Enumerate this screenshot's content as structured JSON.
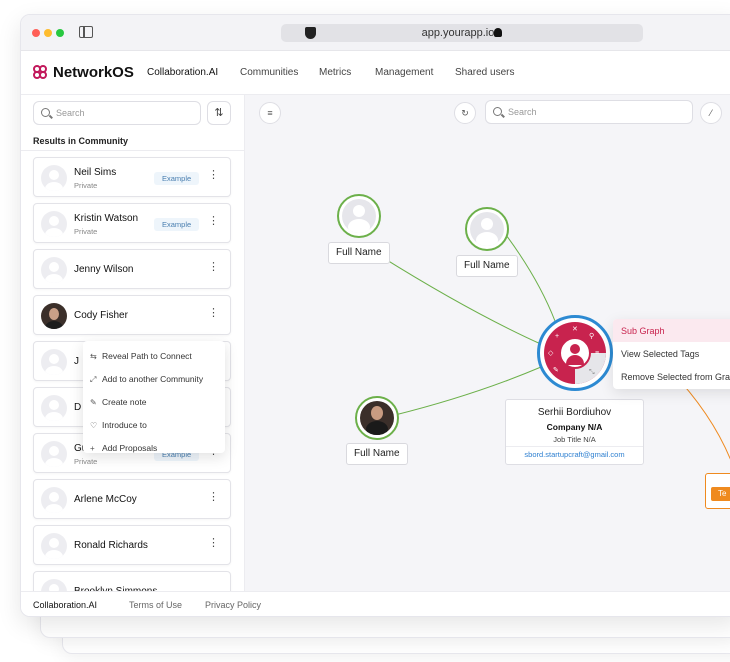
{
  "browser": {
    "url": "app.yourapp.io"
  },
  "brand": {
    "name": "NetworkOS",
    "color": "#c2185b"
  },
  "nav": {
    "items": [
      "Collaboration.AI",
      "Communities",
      "Metrics",
      "Management",
      "Shared users"
    ],
    "active": "Collaboration.AI"
  },
  "left_panel": {
    "search_placeholder": "Search",
    "results_title": "Results in Community",
    "cards": [
      {
        "name": "Neil Sims",
        "sub": "Private",
        "badge": "Example"
      },
      {
        "name": "Kristin Watson",
        "sub": "Private",
        "badge": "Example"
      },
      {
        "name": "Jenny Wilson"
      },
      {
        "name": "Cody Fisher"
      },
      {
        "name": "J"
      },
      {
        "name": "D"
      },
      {
        "name": "Guy Hawkins",
        "sub": "Private",
        "badge": "Example"
      },
      {
        "name": "Arlene McCoy"
      },
      {
        "name": "Ronald Richards"
      },
      {
        "name": "Brooklyn Simmons"
      }
    ],
    "context_menu": [
      {
        "icon": "path-icon",
        "label": "Reveal Path to Connect"
      },
      {
        "icon": "community-icon",
        "label": "Add to another Community"
      },
      {
        "icon": "pencil-icon",
        "label": "Create note"
      },
      {
        "icon": "handshake-icon",
        "label": "Introduce to"
      },
      {
        "icon": "plus-icon",
        "label": "Add Proposals"
      }
    ]
  },
  "graph": {
    "search_placeholder": "Search",
    "nodes": [
      {
        "label": "Full Name"
      },
      {
        "label": "Full Name"
      },
      {
        "label": "Full Name"
      }
    ],
    "center": {
      "name": "Serhii Bordiuhov",
      "company": "Company N/A",
      "title": "Job Title N/A",
      "email": "sbord.startupcraft@gmail.com"
    },
    "context_menu": [
      {
        "label": "Sub Graph",
        "active": true
      },
      {
        "label": "View Selected Tags"
      },
      {
        "label": "Remove Selected from Graph"
      }
    ],
    "orange_tag": "Te",
    "colors": {
      "green_edge": "#6cb04a",
      "orange_edge": "#ef8a1f",
      "center_ring": "#2d8ad2",
      "center_fill": "#c8234e"
    }
  },
  "footer": {
    "brand": "Collaboration.AI",
    "links": [
      "Terms of Use",
      "Privacy Policy"
    ]
  }
}
